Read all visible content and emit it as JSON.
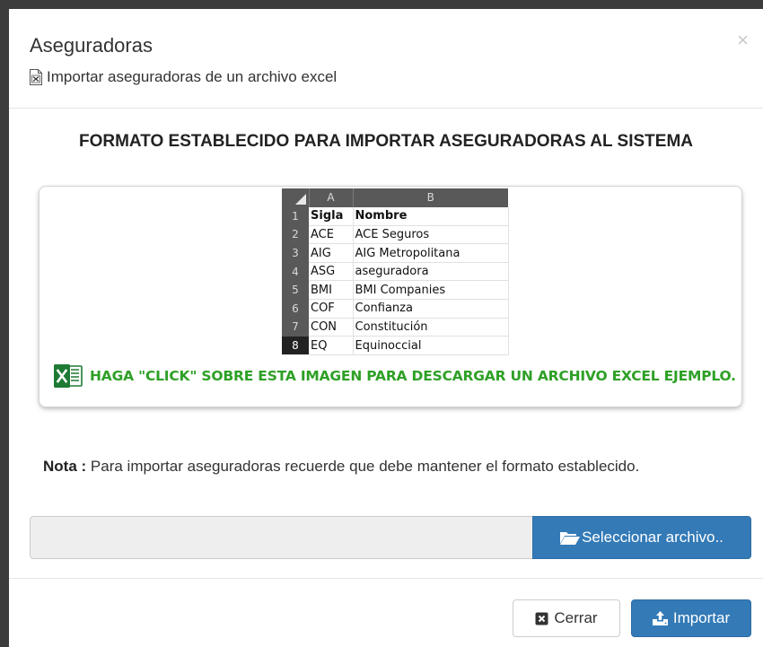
{
  "modal": {
    "title": "Aseguradoras",
    "subtitle": "Importar aseguradoras de un archivo excel",
    "close_symbol": "×"
  },
  "format_title": "FORMATO ESTABLECIDO PARA IMPORTAR ASEGURADORAS AL SISTEMA",
  "spreadsheet": {
    "columns": [
      "A",
      "B"
    ],
    "rows": [
      {
        "n": "1",
        "a": "Sigla",
        "b": "Nombre"
      },
      {
        "n": "2",
        "a": "ACE",
        "b": "ACE Seguros"
      },
      {
        "n": "3",
        "a": "AIG",
        "b": "AIG Metropolitana"
      },
      {
        "n": "4",
        "a": "ASG",
        "b": "aseguradora"
      },
      {
        "n": "5",
        "a": "BMI",
        "b": "BMI Companies"
      },
      {
        "n": "6",
        "a": "COF",
        "b": "Confianza"
      },
      {
        "n": "7",
        "a": "CON",
        "b": "Constitución"
      },
      {
        "n": "8",
        "a": "EQ",
        "b": "Equinoccial"
      }
    ]
  },
  "download_text": "HAGA \"CLICK\" SOBRE ESTA IMAGEN PARA DESCARGAR UN ARCHIVO EXCEL EJEMPLO.",
  "note": {
    "label": "Nota :",
    "text": "Para importar aseguradoras recuerde que debe mantener el formato establecido."
  },
  "file_select": {
    "button_label": "Seleccionar archivo..",
    "value": ""
  },
  "footer": {
    "close_label": "Cerrar",
    "import_label": "Importar"
  },
  "colors": {
    "primary": "#337ab7",
    "excel_green": "#2ea026"
  },
  "icons": [
    "excel-file-icon",
    "close-icon",
    "excel-icon",
    "folder-open-icon",
    "close-square-icon",
    "upload-icon"
  ]
}
